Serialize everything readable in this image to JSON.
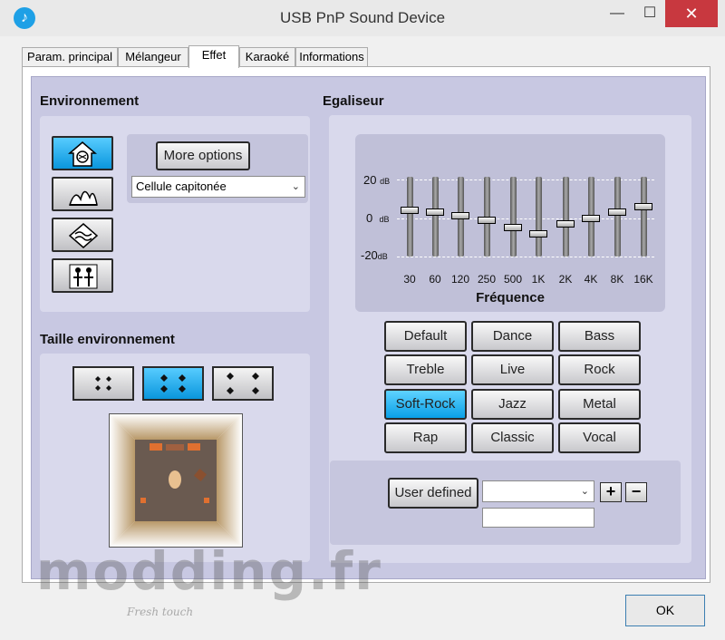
{
  "window": {
    "title": "USB PnP Sound Device",
    "minimize": "—",
    "maximize": "☐",
    "close": "✕",
    "app_icon": "speaker-icon"
  },
  "tabs": [
    {
      "label": "Param. principal",
      "active": false
    },
    {
      "label": "Mélangeur",
      "active": false
    },
    {
      "label": "Effet",
      "active": true
    },
    {
      "label": "Karaoké",
      "active": false
    },
    {
      "label": "Informations",
      "active": false
    }
  ],
  "environment": {
    "title": "Environnement",
    "more_options": "More options",
    "preset": "Cellule capitonée",
    "buttons": [
      {
        "name": "padded-cell-icon",
        "active": true
      },
      {
        "name": "concert-hall-icon",
        "active": false
      },
      {
        "name": "stone-room-icon",
        "active": false
      },
      {
        "name": "living-room-icon",
        "active": false
      }
    ]
  },
  "environment_size": {
    "title": "Taille environnement",
    "sizes": [
      {
        "name": "small",
        "active": false
      },
      {
        "name": "medium",
        "active": true
      },
      {
        "name": "large",
        "active": false
      }
    ]
  },
  "equalizer": {
    "title": "Egaliseur",
    "db_labels": [
      "20",
      "0",
      "-20"
    ],
    "db_unit": "dB",
    "frequency_label": "Fréquence",
    "bands": [
      "30",
      "60",
      "120",
      "250",
      "500",
      "1K",
      "2K",
      "4K",
      "8K",
      "16K"
    ],
    "band_levels_db": [
      4,
      3,
      1,
      -1,
      -5,
      -8,
      -3,
      0,
      3,
      6
    ],
    "presets": [
      {
        "label": "Default",
        "active": false
      },
      {
        "label": "Dance",
        "active": false
      },
      {
        "label": "Bass",
        "active": false
      },
      {
        "label": "Treble",
        "active": false
      },
      {
        "label": "Live",
        "active": false
      },
      {
        "label": "Rock",
        "active": false
      },
      {
        "label": "Soft-Rock",
        "active": true
      },
      {
        "label": "Jazz",
        "active": false
      },
      {
        "label": "Metal",
        "active": false
      },
      {
        "label": "Rap",
        "active": false
      },
      {
        "label": "Classic",
        "active": false
      },
      {
        "label": "Vocal",
        "active": false
      }
    ],
    "user_defined": "User defined",
    "user_select_value": "",
    "user_name_value": "",
    "add": "+",
    "remove": "−"
  },
  "ok_label": "OK",
  "watermark": {
    "text": "modding.fr",
    "tagline": "Fresh touch"
  },
  "colors": {
    "accent": "#0aa0e6",
    "panel": "#c8c8e2"
  }
}
